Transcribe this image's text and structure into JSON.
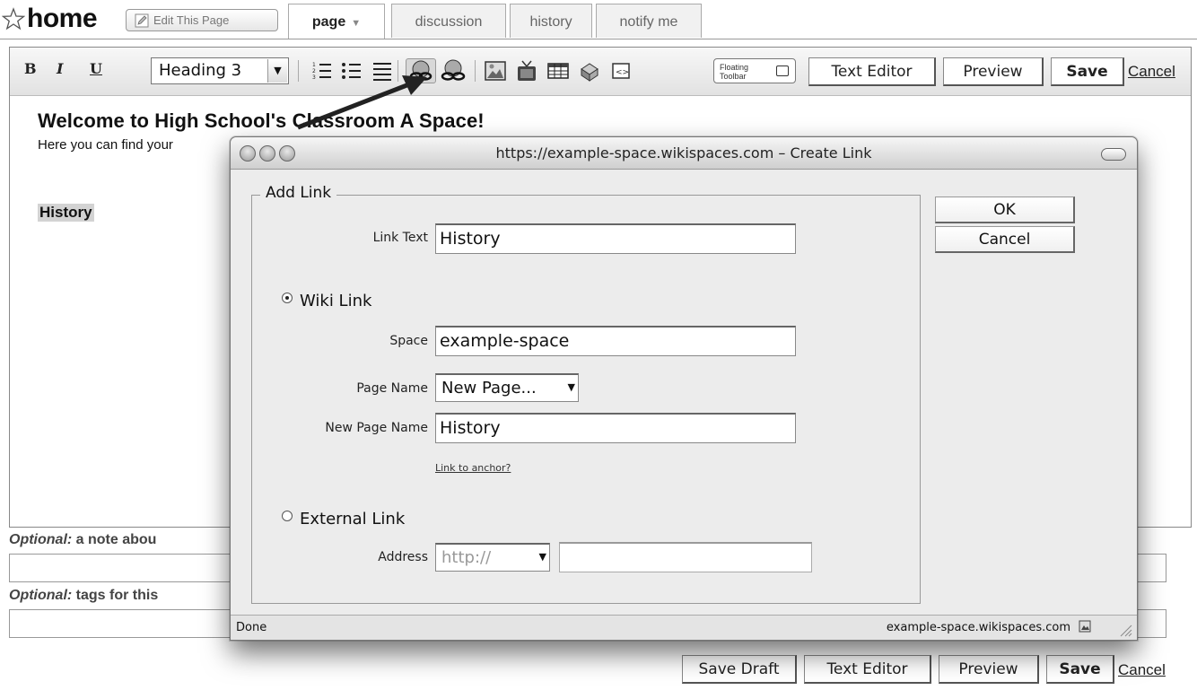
{
  "header": {
    "title": "home",
    "edit_button": "Edit This Page",
    "tabs": [
      {
        "label": "page",
        "caret": "▼"
      },
      {
        "label": "discussion"
      },
      {
        "label": "history"
      },
      {
        "label": "notify me"
      }
    ]
  },
  "toolbar": {
    "bold": "B",
    "italic": "I",
    "underline": "U",
    "heading_value": "Heading 3",
    "floating_toolbar": [
      "Floating",
      "Toolbar"
    ],
    "text_editor": "Text Editor",
    "preview": "Preview",
    "save": "Save",
    "cancel": "Cancel"
  },
  "content": {
    "welcome": "Welcome to High School's Classroom A Space!",
    "intro": "Here you can find your",
    "highlighted": "History"
  },
  "form": {
    "note_label_em": "Optional:",
    "note_label": " a note abou",
    "tags_label_em": "Optional:",
    "tags_label": " tags for this"
  },
  "bottom_actions": {
    "save_draft": "Save Draft",
    "text_editor": "Text Editor",
    "preview": "Preview",
    "save": "Save",
    "cancel": "Cancel"
  },
  "dialog": {
    "title": "https://example-space.wikispaces.com – Create Link",
    "legend": "Add Link",
    "link_text_label": "Link Text",
    "link_text_value": "History",
    "wiki_link_label": "Wiki Link",
    "space_label": "Space",
    "space_value": "example-space",
    "page_name_label": "Page Name",
    "page_name_value": "New Page...",
    "new_page_name_label": "New Page Name",
    "new_page_name_value": "History",
    "anchor_link": "Link to anchor?",
    "external_link_label": "External Link",
    "address_label": "Address",
    "address_protocol": "http://",
    "address_value": "",
    "ok": "OK",
    "cancel": "Cancel",
    "status_left": "Done",
    "status_right": "example-space.wikispaces.com"
  }
}
